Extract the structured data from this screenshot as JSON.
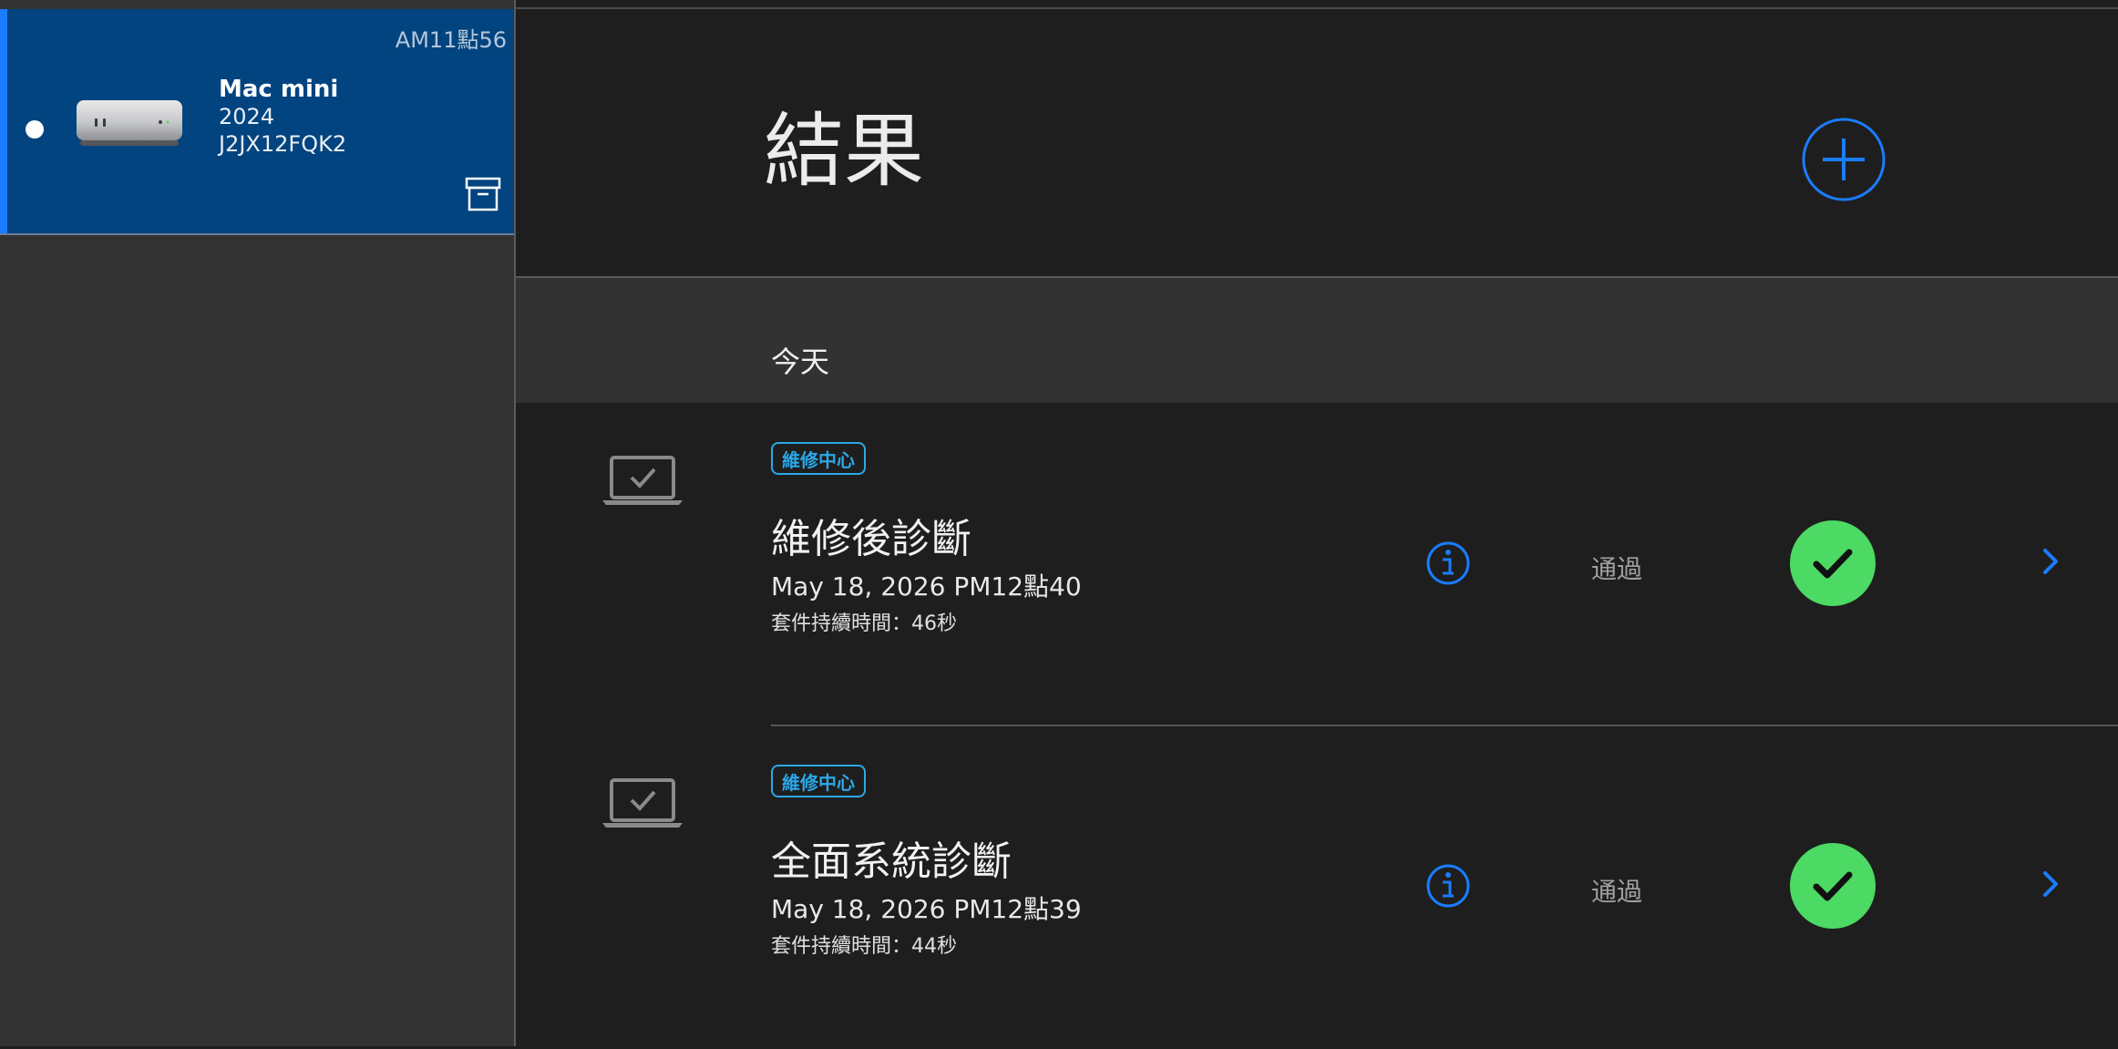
{
  "colors": {
    "sidebar_bg": "#333333",
    "selected_card_bg": "#02447f",
    "accent": "#1a7cff",
    "badge": "#2ba8e8",
    "pass_green": "#4cd964",
    "main_bg": "#1e1e1e"
  },
  "sidebar": {
    "devices": [
      {
        "time": "AM11點56",
        "name": "Mac mini",
        "year": "2024",
        "serial": "J2JX12FQK2",
        "selected": true,
        "image_icon": "mac-mini-icon",
        "action_icon": "archive-box-icon"
      }
    ]
  },
  "header": {
    "title": "結果",
    "add_icon": "plus-circle-icon"
  },
  "sections": [
    {
      "label": "今天",
      "results": [
        {
          "device_icon": "laptop-check-icon",
          "badge": "維修中心",
          "title": "維修後診斷",
          "date": "May 18, 2026 PM12點40",
          "duration": "套件持續時間：46秒",
          "info_icon": "info-icon",
          "status": "通過",
          "status_icon": "checkmark-icon",
          "chevron_icon": "chevron-right-icon"
        },
        {
          "device_icon": "laptop-check-icon",
          "badge": "維修中心",
          "title": "全面系統診斷",
          "date": "May 18, 2026 PM12點39",
          "duration": "套件持續時間：44秒",
          "info_icon": "info-icon",
          "status": "通過",
          "status_icon": "checkmark-icon",
          "chevron_icon": "chevron-right-icon"
        }
      ]
    }
  ]
}
